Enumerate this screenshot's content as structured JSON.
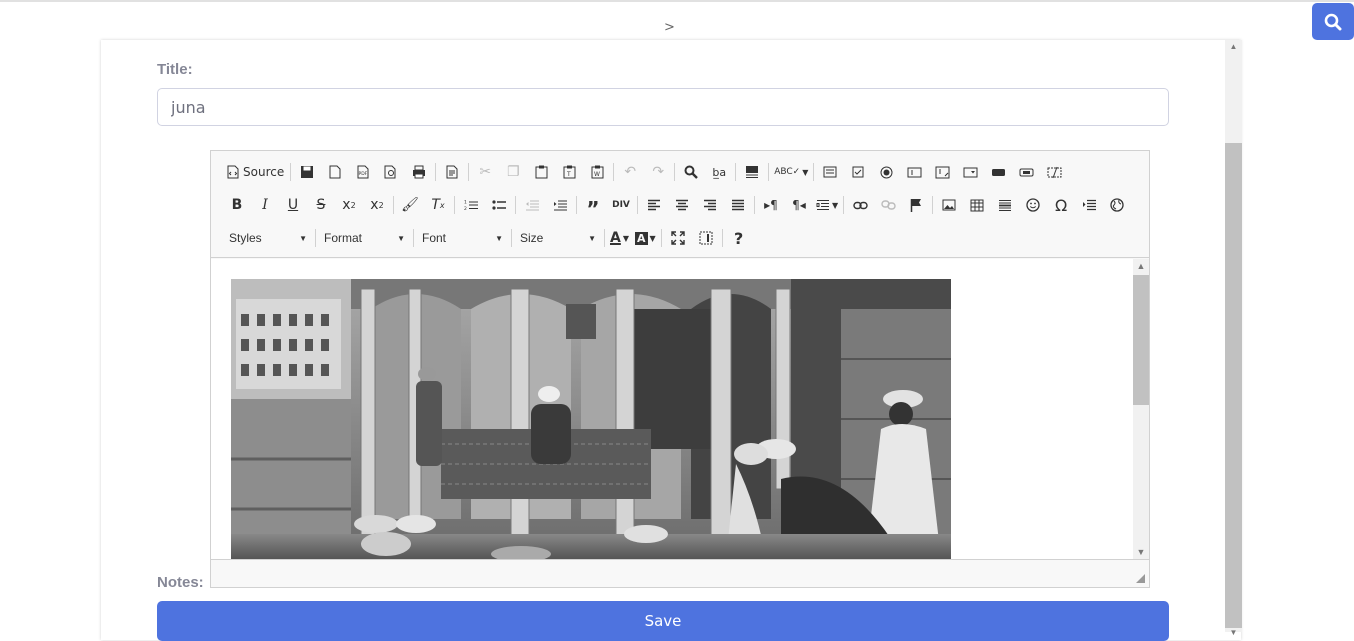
{
  "breadcrumb": {
    "separator": ">"
  },
  "header": {
    "search_icon": "search-icon",
    "accent": "#4e73df"
  },
  "form": {
    "title_label": "Title:",
    "title_value": "juna",
    "notes_label": "Notes:",
    "save_label": "Save"
  },
  "editor": {
    "source_label": "Source",
    "combos": {
      "styles": "Styles",
      "format": "Format",
      "font": "Font",
      "size": "Size"
    },
    "toolbar_row1": [
      "source",
      "save",
      "new-page",
      "export-pdf",
      "preview",
      "print",
      "templates",
      "cut",
      "copy",
      "paste",
      "paste-text",
      "paste-word",
      "undo",
      "redo",
      "find",
      "replace",
      "select-all",
      "spell-check",
      "form",
      "checkbox",
      "radio",
      "text-field",
      "textarea",
      "select",
      "button",
      "image-button",
      "hidden-field"
    ],
    "toolbar_row2": [
      "bold",
      "italic",
      "underline",
      "strike",
      "subscript",
      "superscript",
      "copy-format",
      "remove-format",
      "numbered-list",
      "bulleted-list",
      "outdent",
      "indent",
      "blockquote",
      "div",
      "align-left",
      "align-center",
      "align-right",
      "justify",
      "ltr",
      "rtl",
      "language",
      "link",
      "unlink",
      "anchor",
      "image",
      "table",
      "horizontal-rule",
      "smiley",
      "special-char",
      "page-break",
      "iframe"
    ],
    "toolbar_row3": [
      "text-color",
      "background-color",
      "maximize",
      "show-blocks",
      "about"
    ],
    "content_image": "black-and-white photograph of a wooden arcaded veranda with seated and standing men"
  }
}
